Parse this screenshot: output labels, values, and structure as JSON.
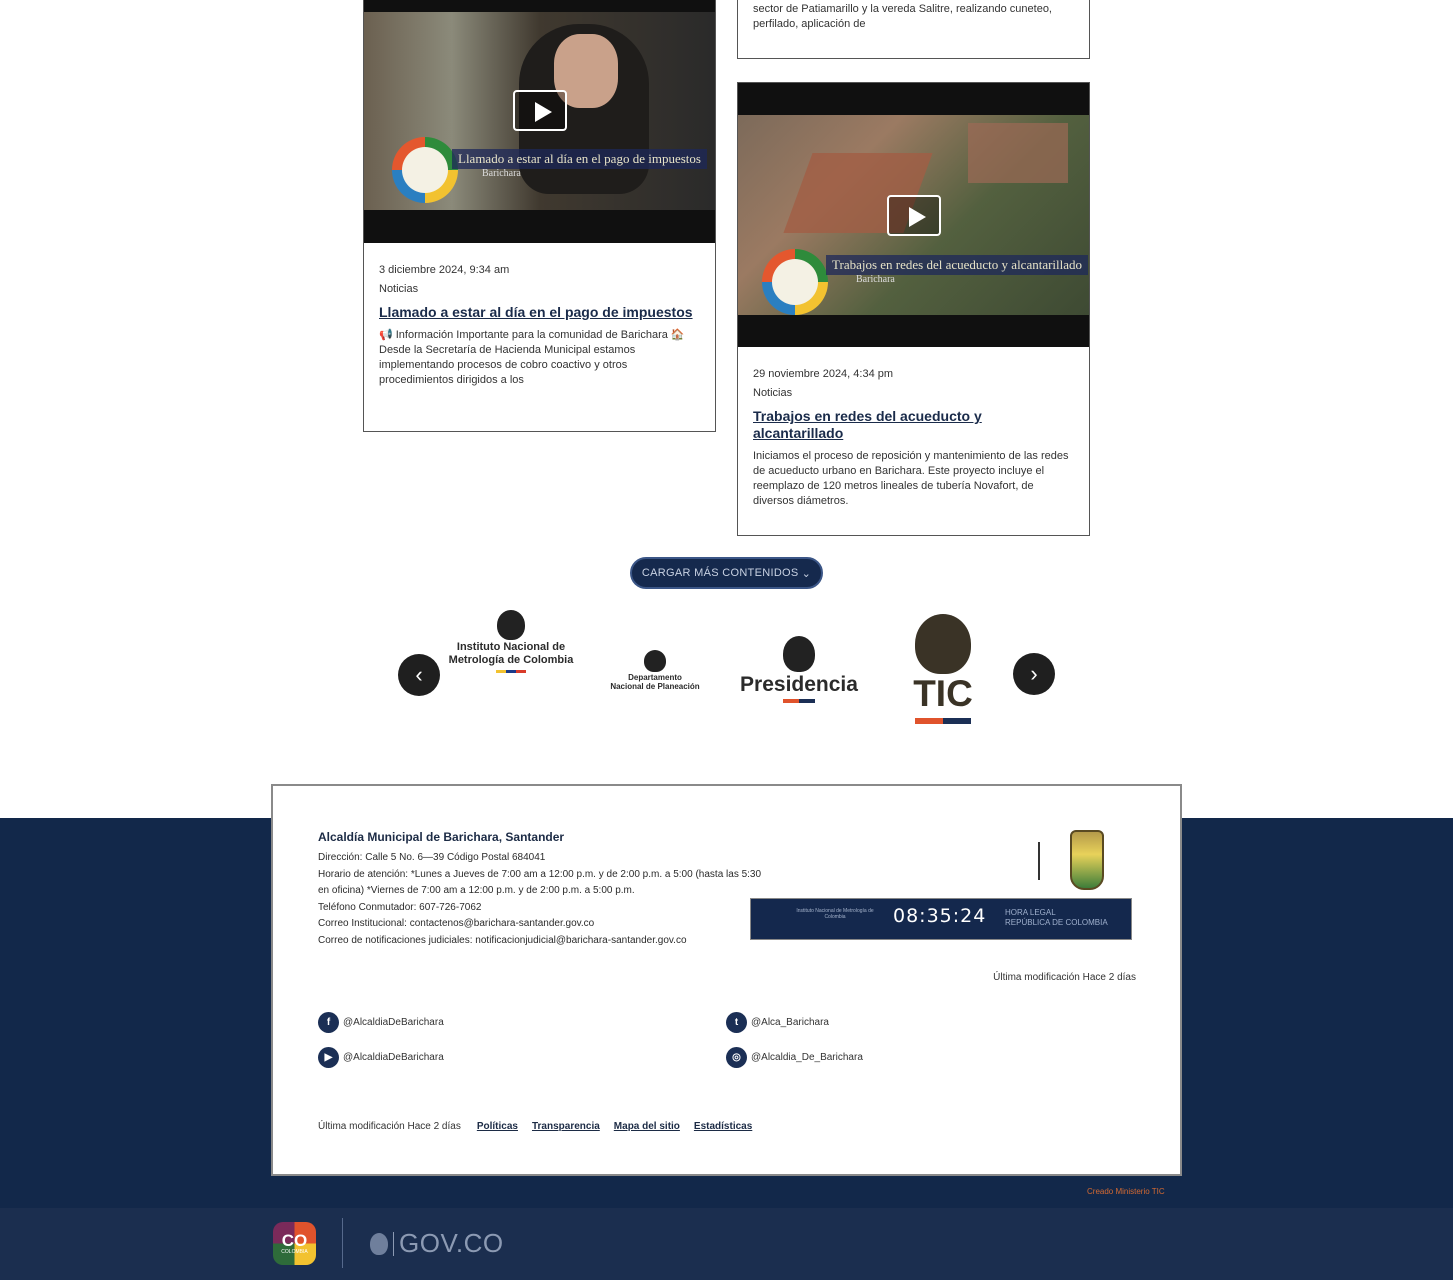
{
  "cards": [
    {
      "partial_excerpt": "sector de Patiamarillo y la vereda Salitre, realizando cuneteo, perfilado, aplicación de"
    },
    {
      "video_caption": "Llamado a estar al día en el pago de impuestos",
      "video_sub": "Barichara",
      "date": "3 diciembre 2024, 9:34 am",
      "category": "Noticias",
      "title": "Llamado a estar al día en el pago de impuestos",
      "excerpt": "📢 Información Importante para la comunidad de Barichara 🏠 Desde la Secretaría de Hacienda Municipal estamos implementando procesos de cobro coactivo y otros procedimientos dirigidos a los"
    },
    {
      "video_caption": "Trabajos en redes del acueducto y alcantarillado",
      "video_sub": "Barichara",
      "date": "29 noviembre 2024, 4:34 pm",
      "category": "Noticias",
      "title": "Trabajos en redes del acueducto y alcantarillado",
      "excerpt": "Iniciamos el proceso de reposición y mantenimiento de las redes de acueducto urbano en Barichara. Este proyecto incluye el reemplazo de 120 metros lineales de tubería Novafort, de diversos diámetros."
    }
  ],
  "load_more": {
    "label": "CARGAR MÁS CONTENIDOS",
    "icon": "chevron-down-icon"
  },
  "logos": {
    "prev_icon": "chevron-left-icon",
    "next_icon": "chevron-right-icon",
    "items": [
      {
        "line1": "Instituto Nacional de",
        "line2": "Metrología de Colombia"
      },
      {
        "line1": "Departamento",
        "line2": "Nacional de Planeación"
      },
      {
        "line1": "Presidencia"
      },
      {
        "line1": "TIC"
      }
    ]
  },
  "footer": {
    "title": "Alcaldía Municipal de Barichara, Santander",
    "lines": [
      "Dirección: Calle 5 No. 6—39 Código Postal 684041",
      "Horario de atención: *Lunes a Jueves de 7:00 am a 12:00 p.m. y de 2:00 p.m. a 5:00 (hasta las 5:30 en oficina) *Viernes de 7:00 am a 12:00 p.m. y de 2:00 p.m. a 5:00 p.m.",
      "Teléfono Conmutador: 607-726-7062",
      "Correo Institucional: contactenos@barichara-santander.gov.co",
      "Correo de notificaciones judiciales: notificacionjudicial@barichara-santander.gov.co"
    ],
    "clock": {
      "time": "08:35:24",
      "legal_line1": "HORA LEGAL",
      "legal_line2": "REPÚBLICA DE COLOMBIA",
      "inm": "Instituto Nacional de Metrología de Colombia"
    },
    "modified": "Última modificación Hace 2 días",
    "socials": [
      {
        "icon": "facebook-icon",
        "glyph": "f",
        "handle": "@AlcaldiaDeBarichara"
      },
      {
        "icon": "twitter-icon",
        "glyph": "t",
        "handle": "@Alca_Barichara"
      },
      {
        "icon": "youtube-icon",
        "glyph": "▶",
        "handle": "@AlcaldiaDeBarichara"
      },
      {
        "icon": "instagram-icon",
        "glyph": "◎",
        "handle": "@Alcaldia_De_Barichara"
      }
    ],
    "bottom": {
      "modified": "Última modificación Hace 2 días",
      "links": [
        "Políticas",
        "Transparencia",
        "Mapa del sitio",
        "Estadísticas"
      ]
    }
  },
  "credit": "Creado Ministerio TIC",
  "govbar": {
    "co_text": "CO",
    "co_sub": "COLOMBIA",
    "gov_text": "GOV.CO"
  },
  "colors": {
    "navy": "#12284a",
    "govbar": "#1b2e4f",
    "accent": "#d46a32"
  }
}
